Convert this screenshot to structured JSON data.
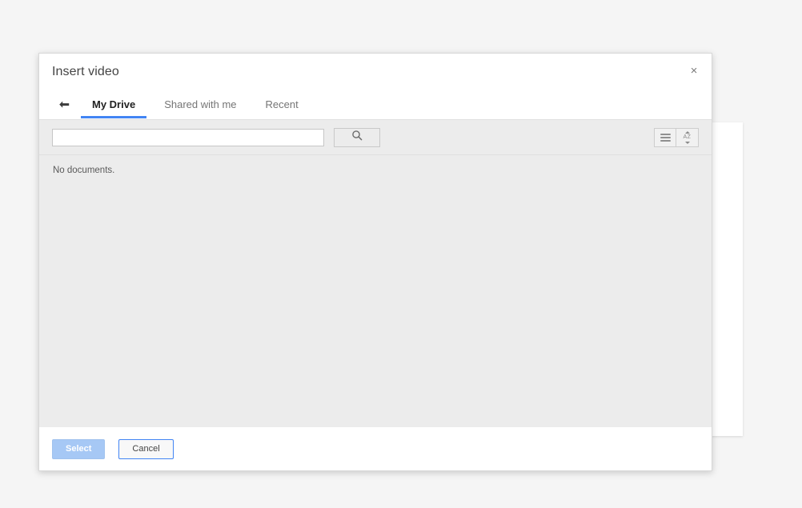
{
  "dialog": {
    "title": "Insert video",
    "close_label": "×"
  },
  "tabs": {
    "back_icon": "back-arrow-icon",
    "items": [
      {
        "label": "My Drive",
        "active": true
      },
      {
        "label": "Shared with me",
        "active": false
      },
      {
        "label": "Recent",
        "active": false
      }
    ]
  },
  "toolbar": {
    "search_value": "",
    "search_placeholder": "",
    "search_button_icon": "search-icon",
    "list_view_icon": "list-view-icon",
    "sort_icon": "sort-az-icon",
    "sort_icon_text": "AZ"
  },
  "content": {
    "empty_message": "No documents."
  },
  "footer": {
    "select_label": "Select",
    "cancel_label": "Cancel"
  },
  "colors": {
    "accent_blue": "#4285f4",
    "select_disabled_blue": "#a6c8f5",
    "toolbar_gray": "#ececec",
    "page_background": "#f5f5f5"
  }
}
